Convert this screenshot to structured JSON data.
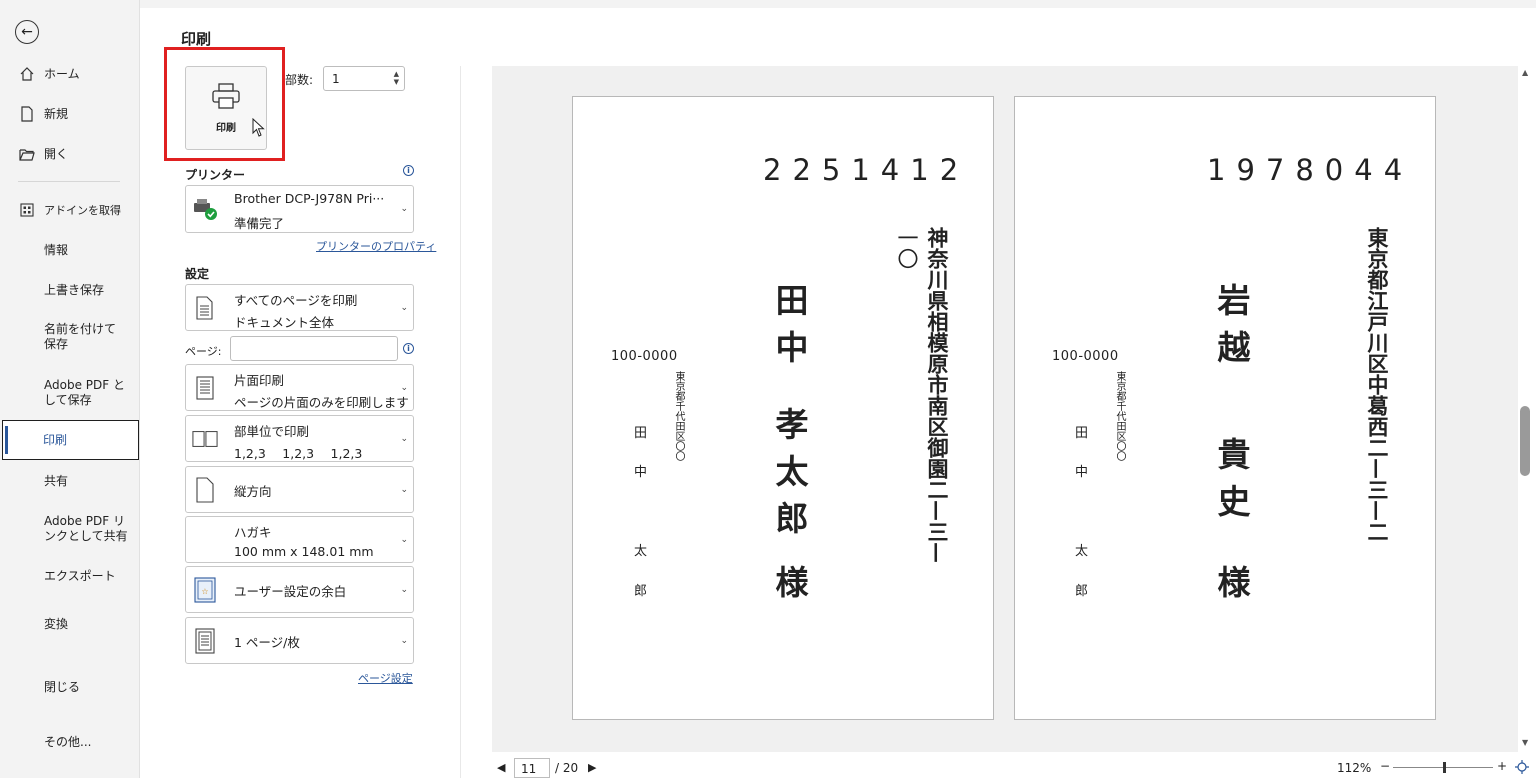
{
  "sidebar": {
    "back_icon": "back-arrow-icon",
    "items": [
      {
        "label": "ホーム",
        "icon": "home-icon"
      },
      {
        "label": "新規",
        "icon": "new-doc-icon"
      },
      {
        "label": "開く",
        "icon": "folder-icon"
      },
      {
        "label": "アドインを取得",
        "icon": "addin-grid-icon"
      },
      {
        "label": "情報"
      },
      {
        "label": "上書き保存"
      },
      {
        "label": "名前を付けて保存"
      },
      {
        "label": "Adobe PDF として保存"
      },
      {
        "label": "印刷"
      },
      {
        "label": "共有"
      },
      {
        "label": "Adobe PDF リンクとして共有"
      },
      {
        "label": "エクスポート"
      },
      {
        "label": "変換"
      },
      {
        "label": "閉じる"
      },
      {
        "label": "その他..."
      }
    ],
    "active": "印刷"
  },
  "print": {
    "title": "印刷",
    "button_label": "印刷",
    "copies_label": "部数:",
    "copies_value": "1"
  },
  "printer": {
    "heading": "プリンター",
    "name": "Brother DCP-J978N Pri···",
    "status": "準備完了",
    "properties_link": "プリンターのプロパティ"
  },
  "settings": {
    "heading": "設定",
    "pages_label": "ページ:",
    "pages_value": "",
    "page_setup_link": "ページ設定",
    "options": [
      {
        "l1": "すべてのページを印刷",
        "l2": "ドキュメント全体",
        "icon": "pages-icon"
      },
      {
        "l1": "片面印刷",
        "l2": "ページの片面のみを印刷します",
        "icon": "one-sided-icon"
      },
      {
        "l1": "部単位で印刷",
        "l2": "1,2,3　 1,2,3　 1,2,3",
        "icon": "collate-icon"
      },
      {
        "l1": "縦方向",
        "l2": "",
        "icon": "portrait-icon"
      },
      {
        "l1": "ハガキ",
        "l2": "100 mm x 148.01 mm",
        "icon": ""
      },
      {
        "l1": "ユーザー設定の余白",
        "l2": "",
        "icon": "margins-icon"
      },
      {
        "l1": "1 ページ/枚",
        "l2": "",
        "icon": "pages-per-sheet-icon"
      }
    ]
  },
  "preview": {
    "cards": [
      {
        "zip": "2251412",
        "address": "神奈川県相模原市南区御園二—三—",
        "address2": "一〇",
        "name_family": "田中",
        "name_given": "孝太郎",
        "honorific": "様",
        "return_zip": "100-0000",
        "return_address": "東京都千代田区〇〇",
        "return_name": [
          "田",
          "中",
          "太",
          "郎"
        ]
      },
      {
        "zip": "1978044",
        "address": "東京都江戸川区中葛西二—三—二",
        "address2": "",
        "name_family": "岩越",
        "name_given": "貴史",
        "honorific": "様",
        "return_zip": "100-0000",
        "return_address": "東京都千代田区〇〇",
        "return_name": [
          "田",
          "中",
          "太",
          "郎"
        ]
      }
    ]
  },
  "footer": {
    "current_page": "11",
    "total_pages": "/ 20",
    "zoom": "112%",
    "zoom_minus": "−",
    "zoom_plus": "+"
  }
}
